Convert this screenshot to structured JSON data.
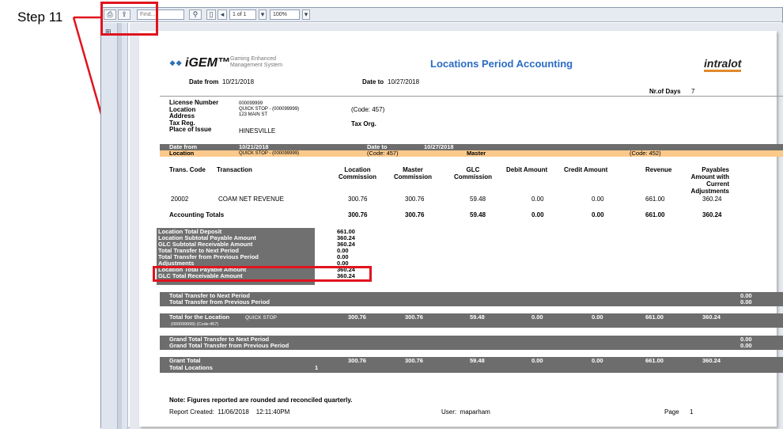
{
  "annotation": {
    "step_label": "Step 11"
  },
  "toolbar": {
    "find_placeholder": "Find...",
    "page_value": "1 of 1",
    "zoom_value": "100%"
  },
  "report": {
    "logo_text": "iGEM™",
    "logo_sub1": "Gaming Enhanced",
    "logo_sub2": "Management System",
    "title": "Locations Period Accounting",
    "brand": "intralot",
    "date_from_label": "Date from",
    "date_from": "10/21/2018",
    "date_to_label": "Date to",
    "date_to": "10/27/2018",
    "nr_days_label": "Nr.of Days",
    "nr_days": "7",
    "info": {
      "license_label": "License Number",
      "license_value": "000099999",
      "location_label": "Location",
      "location_value": "QUICK STOP - (000099999)",
      "address_label": "Address",
      "address_value": "123 MAIN ST",
      "taxreg_label": "Tax Reg.",
      "place_label": "Place of Issue",
      "place_value": "HINESVILLE",
      "code": "(Code: 457)",
      "tax_org": "Tax Org."
    },
    "band": {
      "date_from_label": "Date from",
      "date_from": "10/21/2018",
      "date_to_label": "Date to",
      "date_to": "10/27/2018",
      "location_label": "Location",
      "location_value": "QUICK STOP - (000099999)",
      "code": "(Code: 457)",
      "master": "Master",
      "code2": "(Code: 452)"
    },
    "columns": {
      "trans_code": "Trans. Code",
      "transaction": "Transaction",
      "loc_comm_1": "Location",
      "loc_comm_2": "Commission",
      "master_comm_1": "Master",
      "master_comm_2": "Commission",
      "glc_comm_1": "GLC",
      "glc_comm_2": "Commission",
      "debit": "Debit Amount",
      "credit": "Credit Amount",
      "revenue": "Revenue",
      "payables_1": "Payables",
      "payables_2": "Amount with",
      "payables_3": "Current",
      "payables_4": "Adjustments"
    },
    "row": {
      "code": "20002",
      "transaction": "COAM NET REVENUE",
      "loc_comm": "300.76",
      "master_comm": "300.76",
      "glc_comm": "59.48",
      "debit": "0.00",
      "credit": "0.00",
      "revenue": "661.00",
      "payables": "360.24"
    },
    "totals": {
      "label": "Accounting Totals",
      "loc_comm": "300.76",
      "master_comm": "300.76",
      "glc_comm": "59.48",
      "debit": "0.00",
      "credit": "0.00",
      "revenue": "661.00",
      "payables": "360.24"
    },
    "summary": {
      "l1": "Location Total Deposit",
      "v1": "661.00",
      "l2": "Location Subtotal Payable Amount",
      "v2": "360.24",
      "l3": "GLC Subtotal Receivable Amount",
      "v3": "360.24",
      "l4": "Total Transfer to Next Period",
      "v4": "0.00",
      "l5": "Total Transfer from Previous Period",
      "v5": "0.00",
      "l6": "Adjustments",
      "v6": "0.00",
      "l7": "Location Total Payable Amount",
      "v7": "360.24",
      "l8": "GLC Total Receivable Amount",
      "v8": "360.24"
    },
    "transfer": {
      "l1": "Total Transfer to Next Period",
      "v1": "0.00",
      "l2": "Total Transfer from Previous Period",
      "v2": "0.00"
    },
    "loc_total": {
      "label": "Total for the Location",
      "name": "QUICK STOP",
      "sub": "(000099999) (Code:457)",
      "loc_comm": "300.76",
      "master_comm": "300.76",
      "glc_comm": "59.48",
      "debit": "0.00",
      "credit": "0.00",
      "revenue": "661.00",
      "payables": "360.24"
    },
    "grand_transfer": {
      "l1": "Grand Total Transfer to Next Period",
      "v1": "0.00",
      "l2": "Grand Total Transfer from Previous Period",
      "v2": "0.00"
    },
    "grant_total": {
      "label": "Grant Total",
      "loc_comm": "300.76",
      "master_comm": "300.76",
      "glc_comm": "59.48",
      "debit": "0.00",
      "credit": "0.00",
      "revenue": "661.00",
      "payables": "360.24",
      "locations_label": "Total Locations",
      "locations": "1"
    },
    "footer": {
      "note": "Note: Figures reported are rounded and reconciled quarterly.",
      "created_label": "Report Created:",
      "created_date": "11/06/2018",
      "created_time": "12:11:40PM",
      "user_label": "User:",
      "user": "maparham",
      "page_label": "Page",
      "page": "1"
    }
  }
}
